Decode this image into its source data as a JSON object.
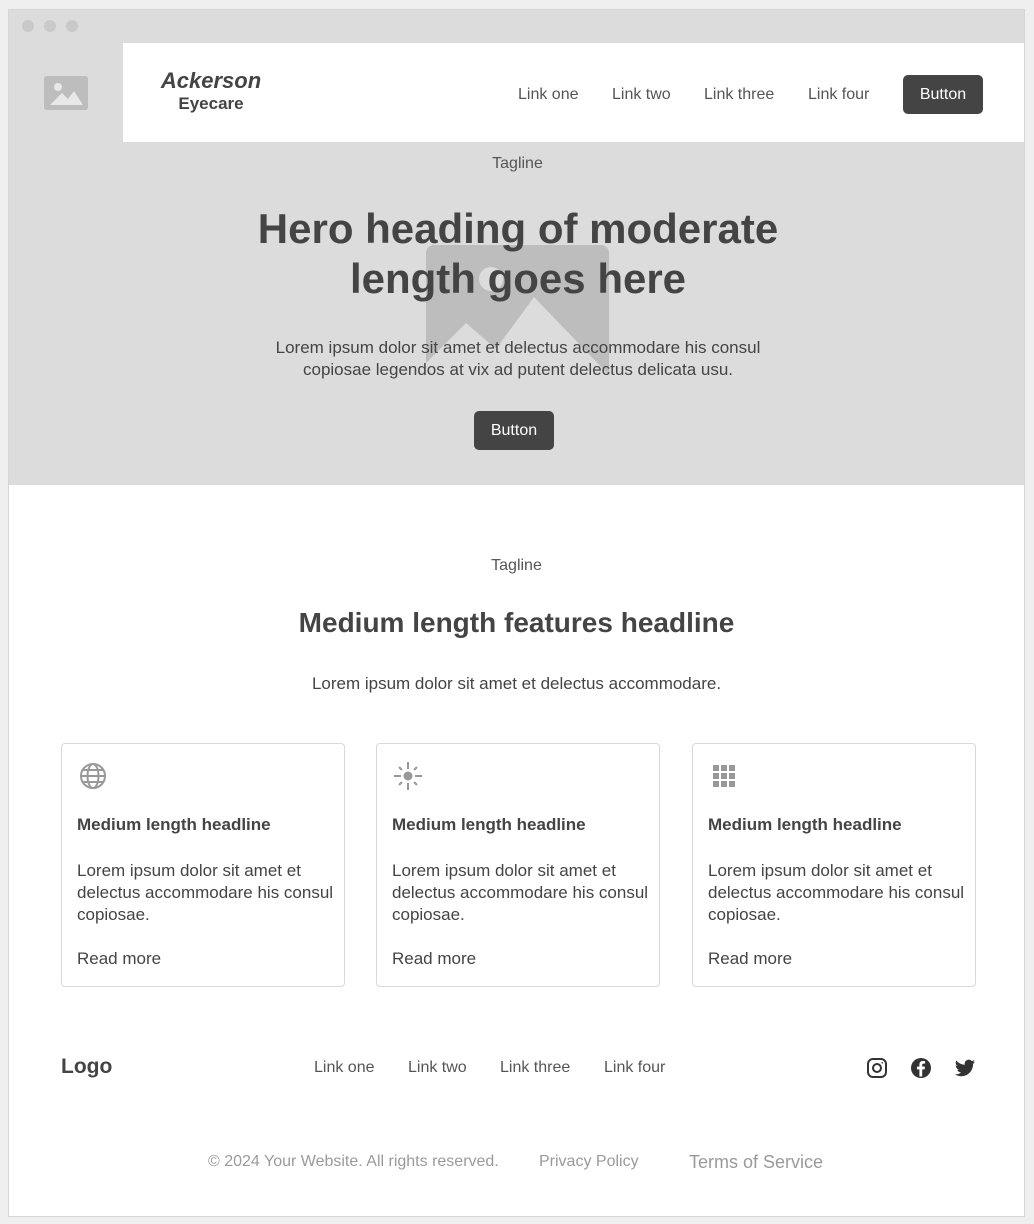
{
  "brand": {
    "line1": "Ackerson",
    "line2": "Eyecare"
  },
  "nav": {
    "links": [
      "Link one",
      "Link two",
      "Link three",
      "Link four"
    ],
    "button": "Button"
  },
  "hero": {
    "tagline": "Tagline",
    "heading": "Hero heading of moderate length goes here",
    "subtext": "Lorem ipsum dolor sit amet et delectus accommodare his consul copiosae legendos at vix ad putent delectus delicata usu.",
    "button": "Button"
  },
  "features": {
    "tagline": "Tagline",
    "headline": "Medium length features headline",
    "subtext": "Lorem ipsum dolor sit amet et delectus accommodare.",
    "cards": [
      {
        "icon": "globe-icon",
        "headline": "Medium length headline",
        "body": "Lorem ipsum dolor sit amet et delectus accommodare his consul copiosae.",
        "link": "Read more"
      },
      {
        "icon": "sparkle-icon",
        "headline": "Medium length headline",
        "body": "Lorem ipsum dolor sit amet et delectus accommodare his consul copiosae.",
        "link": "Read more"
      },
      {
        "icon": "grid-icon",
        "headline": "Medium length headline",
        "body": "Lorem ipsum dolor sit amet et delectus accommodare his consul copiosae.",
        "link": "Read more"
      }
    ]
  },
  "footer": {
    "logo": "Logo",
    "links": [
      "Link one",
      "Link two",
      "Link three",
      "Link four"
    ],
    "social": [
      "instagram-icon",
      "facebook-icon",
      "twitter-icon"
    ],
    "copyright": "© 2024 Your Website. All rights reserved.",
    "privacy": "Privacy Policy",
    "terms": "Terms of Service"
  },
  "colors": {
    "dark": "#444444",
    "placeholder": "#dcdcdc",
    "placeholder_shape": "#bdbdbd"
  }
}
